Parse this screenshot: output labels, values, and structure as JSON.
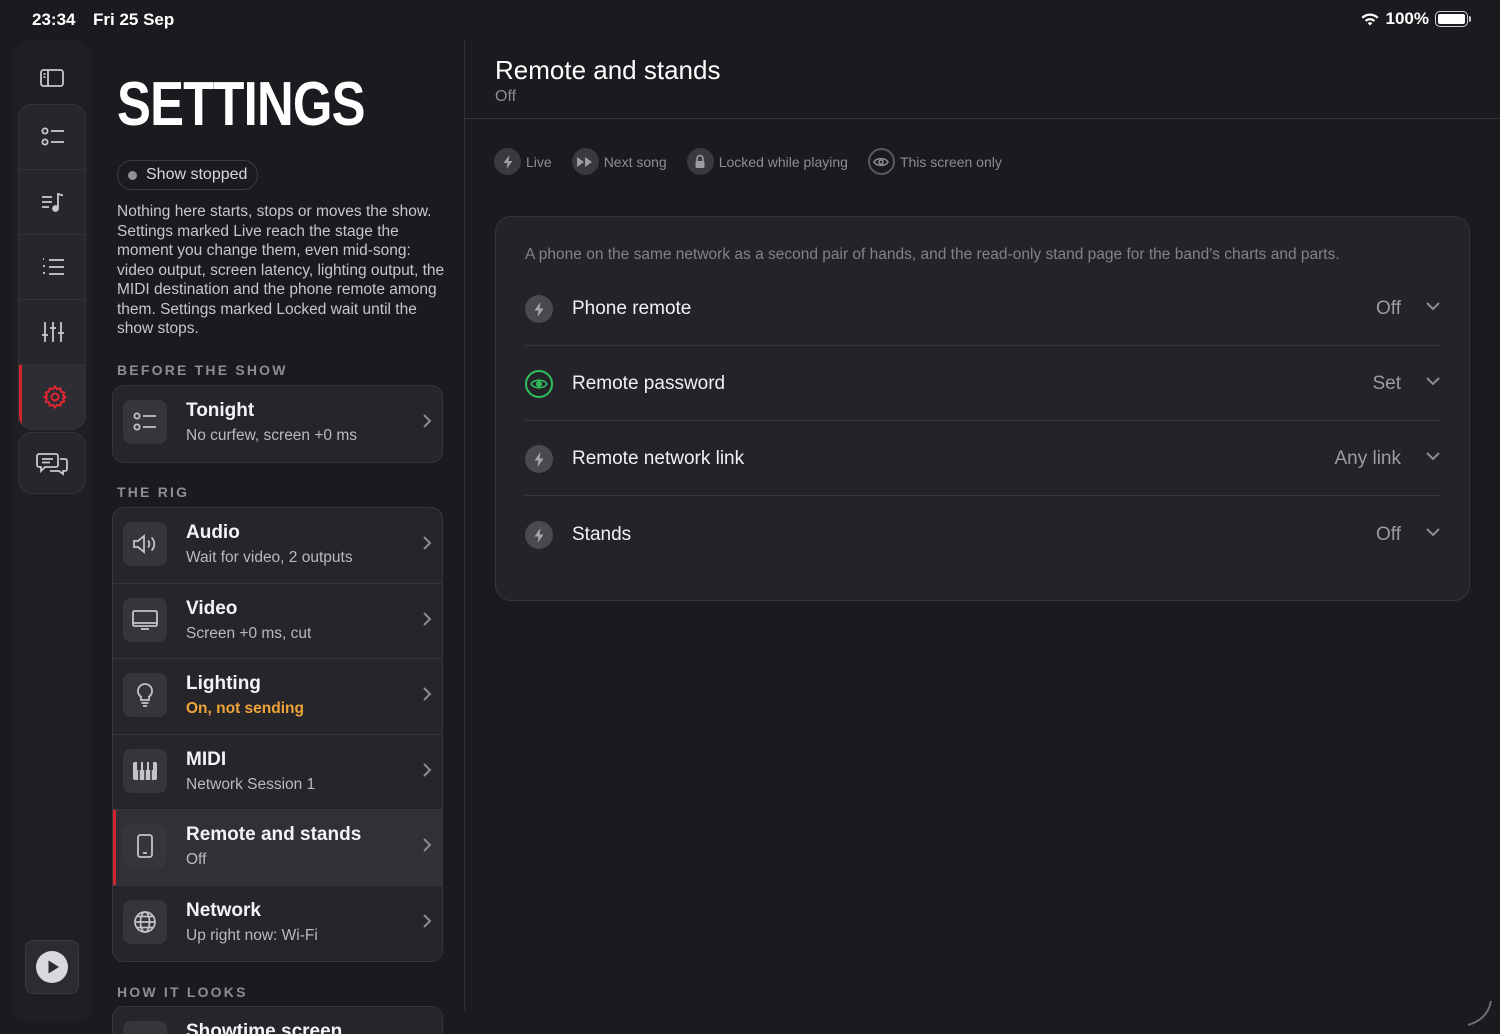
{
  "status_bar": {
    "time": "23:34",
    "date": "Fri 25 Sep",
    "battery": "100%"
  },
  "rail": {
    "items": [
      "sidebar-toggle",
      "checklist",
      "music-queue",
      "setlist",
      "mixer",
      "settings"
    ],
    "active": "settings"
  },
  "settings": {
    "title": "SETTINGS",
    "status_pill": "Show stopped",
    "intro": "Nothing here starts, stops or moves the show. Settings marked Live reach the stage the moment you change them, even mid-song: video output, screen latency, lighting output, the MIDI destination and the phone remote among them. Settings marked Locked wait until the show stops.",
    "sections": {
      "before": "BEFORE THE SHOW",
      "rig": "THE RIG",
      "looks": "HOW IT LOOKS"
    },
    "before_items": [
      {
        "title": "Tonight",
        "sub": "No curfew, screen +0 ms"
      }
    ],
    "rig_items": [
      {
        "title": "Audio",
        "sub": "Wait for video, 2 outputs"
      },
      {
        "title": "Video",
        "sub": "Screen +0 ms, cut"
      },
      {
        "title": "Lighting",
        "sub": "On, not sending"
      },
      {
        "title": "MIDI",
        "sub": "Network Session 1"
      },
      {
        "title": "Remote and stands",
        "sub": "Off"
      },
      {
        "title": "Network",
        "sub": "Up right now: Wi-Fi"
      }
    ],
    "looks_items": [
      {
        "title": "Showtime screen"
      }
    ]
  },
  "detail": {
    "title": "Remote and stands",
    "subtitle": "Off",
    "legend": [
      "Live",
      "Next song",
      "Locked while playing",
      "This screen only"
    ],
    "description": "A phone on the same network as a second pair of hands, and the read-only stand page for the band's charts and parts.",
    "rows": [
      {
        "label": "Phone remote",
        "value": "Off",
        "icon": "bolt-icon"
      },
      {
        "label": "Remote password",
        "value": "Set",
        "icon": "eye-icon"
      },
      {
        "label": "Remote network link",
        "value": "Any link",
        "icon": "bolt-icon"
      },
      {
        "label": "Stands",
        "value": "Off",
        "icon": "bolt-icon"
      }
    ]
  },
  "colors": {
    "accent": "#d0242f",
    "warning": "#efa43a",
    "success": "#2fbf5a",
    "background": "#1b1a1f"
  }
}
